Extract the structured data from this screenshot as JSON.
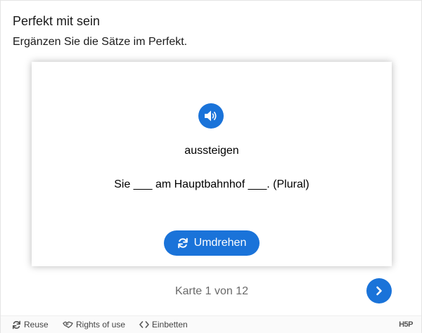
{
  "header": {
    "title": "Perfekt mit sein",
    "instruction": "Ergänzen Sie die Sätze im Perfekt."
  },
  "card": {
    "audio_icon": "speaker-icon",
    "word": "aussteigen",
    "sentence": "Sie ___ am Hauptbahnhof ___. (Plural)",
    "flip_label": "Umdrehen",
    "flip_icon": "sync-icon"
  },
  "navigation": {
    "counter": "Karte 1 von 12",
    "next_icon": "chevron-right-icon"
  },
  "footer": {
    "reuse_label": "Reuse",
    "rights_label": "Rights of use",
    "embed_label": "Einbetten",
    "logo_text": "H5P"
  },
  "colors": {
    "accent": "#1a73d9",
    "muted_text": "#6a6a6a",
    "footer_bg": "#fafafa"
  }
}
